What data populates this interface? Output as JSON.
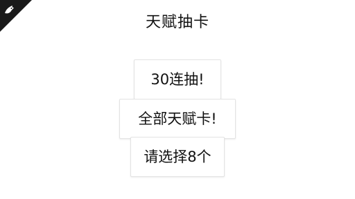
{
  "header": {
    "title": "天赋抽卡",
    "corner_icon": "dragon-logo-icon"
  },
  "actions": {
    "draw_30_label": "30连抽!",
    "all_talent_cards_label": "全部天赋卡!",
    "select_8_label": "请选择8个"
  }
}
